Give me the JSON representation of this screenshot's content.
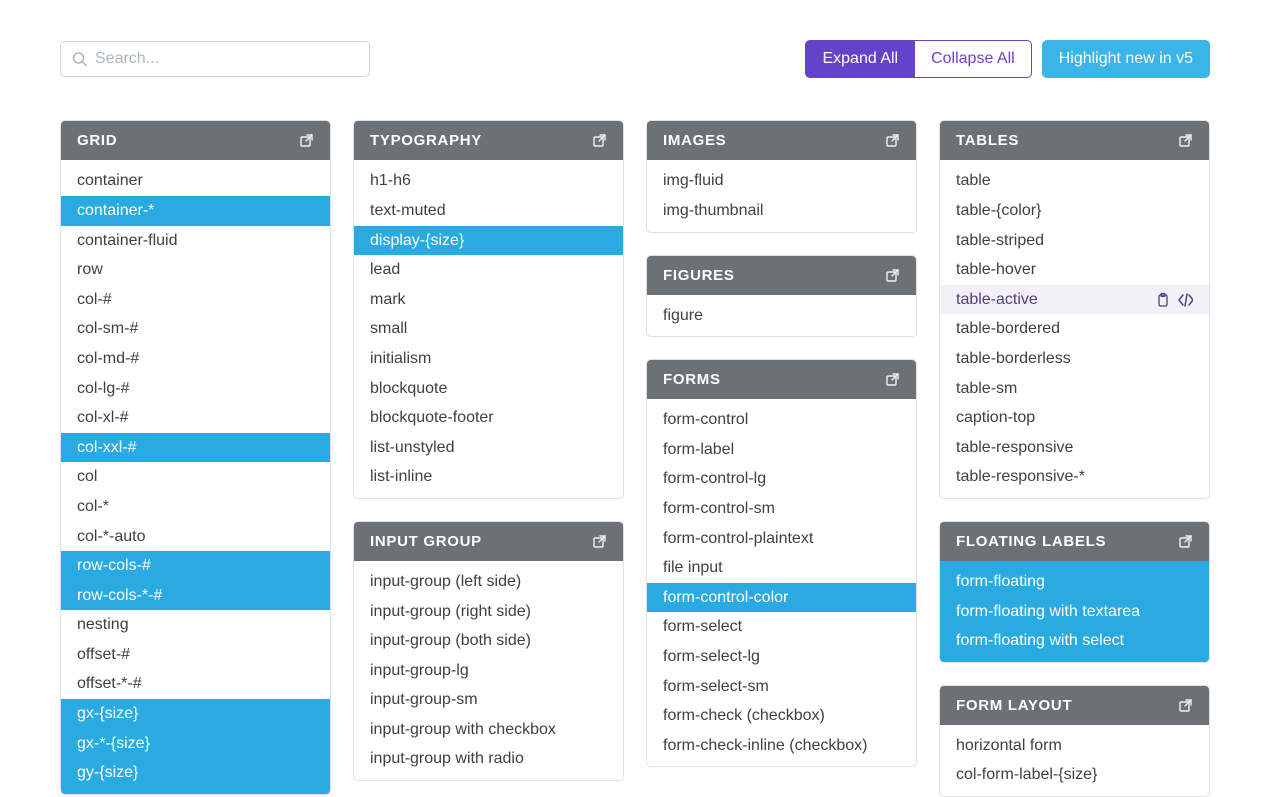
{
  "search": {
    "placeholder": "Search..."
  },
  "toolbar": {
    "expand_label": "Expand All",
    "collapse_label": "Collapse All",
    "highlight_label": "Highlight new in v5"
  },
  "panels": {
    "grid": {
      "title": "GRID",
      "items": [
        {
          "label": "container"
        },
        {
          "label": "container-*",
          "highlight": true
        },
        {
          "label": "container-fluid"
        },
        {
          "label": "row"
        },
        {
          "label": "col-#"
        },
        {
          "label": "col-sm-#"
        },
        {
          "label": "col-md-#"
        },
        {
          "label": "col-lg-#"
        },
        {
          "label": "col-xl-#"
        },
        {
          "label": "col-xxl-#",
          "highlight": true
        },
        {
          "label": "col"
        },
        {
          "label": "col-*"
        },
        {
          "label": "col-*-auto"
        },
        {
          "label": "row-cols-#",
          "highlight": true
        },
        {
          "label": "row-cols-*-#",
          "highlight": true
        },
        {
          "label": "nesting"
        },
        {
          "label": "offset-#"
        },
        {
          "label": "offset-*-#"
        },
        {
          "label": "gx-{size}",
          "highlight": true
        },
        {
          "label": "gx-*-{size}",
          "highlight": true
        },
        {
          "label": "gy-{size}",
          "highlight": true
        }
      ]
    },
    "typography": {
      "title": "TYPOGRAPHY",
      "items": [
        {
          "label": "h1-h6"
        },
        {
          "label": "text-muted"
        },
        {
          "label": "display-{size}",
          "highlight": true
        },
        {
          "label": "lead"
        },
        {
          "label": "mark"
        },
        {
          "label": "small"
        },
        {
          "label": "initialism"
        },
        {
          "label": "blockquote"
        },
        {
          "label": "blockquote-footer"
        },
        {
          "label": "list-unstyled"
        },
        {
          "label": "list-inline"
        }
      ]
    },
    "input_group": {
      "title": "INPUT GROUP",
      "items": [
        {
          "label": "input-group (left side)"
        },
        {
          "label": "input-group (right side)"
        },
        {
          "label": "input-group (both side)"
        },
        {
          "label": "input-group-lg"
        },
        {
          "label": "input-group-sm"
        },
        {
          "label": "input-group with checkbox"
        },
        {
          "label": "input-group with radio"
        }
      ]
    },
    "images": {
      "title": "IMAGES",
      "items": [
        {
          "label": "img-fluid"
        },
        {
          "label": "img-thumbnail"
        }
      ]
    },
    "figures": {
      "title": "FIGURES",
      "items": [
        {
          "label": "figure"
        }
      ]
    },
    "forms": {
      "title": "FORMS",
      "items": [
        {
          "label": "form-control"
        },
        {
          "label": "form-label"
        },
        {
          "label": "form-control-lg"
        },
        {
          "label": "form-control-sm"
        },
        {
          "label": "form-control-plaintext"
        },
        {
          "label": "file input"
        },
        {
          "label": "form-control-color",
          "highlight": true
        },
        {
          "label": "form-select"
        },
        {
          "label": "form-select-lg"
        },
        {
          "label": "form-select-sm"
        },
        {
          "label": "form-check (checkbox)"
        },
        {
          "label": "form-check-inline (checkbox)"
        }
      ]
    },
    "tables": {
      "title": "TABLES",
      "items": [
        {
          "label": "table"
        },
        {
          "label": "table-{color}"
        },
        {
          "label": "table-striped"
        },
        {
          "label": "table-hover"
        },
        {
          "label": "table-active",
          "hovered": true
        },
        {
          "label": "table-bordered"
        },
        {
          "label": "table-borderless"
        },
        {
          "label": "table-sm"
        },
        {
          "label": "caption-top"
        },
        {
          "label": "table-responsive"
        },
        {
          "label": "table-responsive-*"
        }
      ]
    },
    "floating_labels": {
      "title": "FLOATING LABELS",
      "items": [
        {
          "label": "form-floating",
          "highlight": true
        },
        {
          "label": "form-floating with textarea",
          "highlight": true
        },
        {
          "label": "form-floating with select",
          "highlight": true
        }
      ]
    },
    "form_layout": {
      "title": "FORM LAYOUT",
      "items": [
        {
          "label": "horizontal form"
        },
        {
          "label": "col-form-label-{size}"
        }
      ]
    }
  },
  "layout_columns": [
    [
      "grid"
    ],
    [
      "typography",
      "input_group"
    ],
    [
      "images",
      "figures",
      "forms"
    ],
    [
      "tables",
      "floating_labels",
      "form_layout"
    ]
  ]
}
